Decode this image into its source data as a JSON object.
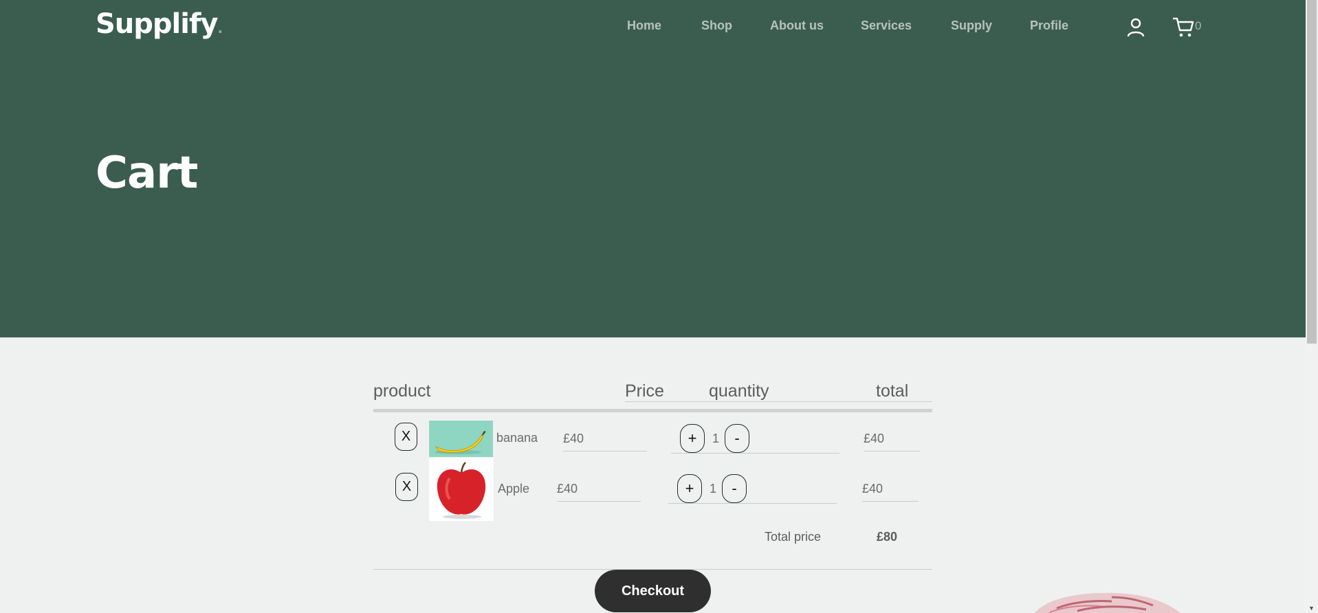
{
  "brand": {
    "name": "Supplify",
    "dot": "."
  },
  "nav": {
    "items": [
      {
        "label": "Home"
      },
      {
        "label": "Shop"
      },
      {
        "label": "About us"
      },
      {
        "label": "Services"
      },
      {
        "label": "Supply"
      },
      {
        "label": "Profile"
      }
    ],
    "cart_count": "0",
    "icons": [
      "user-icon",
      "cart-icon"
    ]
  },
  "page": {
    "title": "Cart"
  },
  "table": {
    "headers": {
      "product": "product",
      "price": "Price",
      "quantity": "quantity",
      "total": "total"
    },
    "rows": [
      {
        "remove": "X",
        "name": "banana",
        "price": "£40",
        "qty": "1",
        "plus": "+",
        "minus": "-",
        "total": "£40"
      },
      {
        "remove": "X",
        "name": "Apple",
        "price": "£40",
        "qty": "1",
        "plus": "+",
        "minus": "-",
        "total": "£40"
      }
    ]
  },
  "summary": {
    "label": "Total price",
    "value": "£80"
  },
  "checkout": {
    "label": "Checkout"
  },
  "colors": {
    "hero": "#3b5d50",
    "page_bg": "#eff1f0",
    "checkout_bg": "#2f2f2f",
    "nav_text": "#b7c3bc"
  }
}
